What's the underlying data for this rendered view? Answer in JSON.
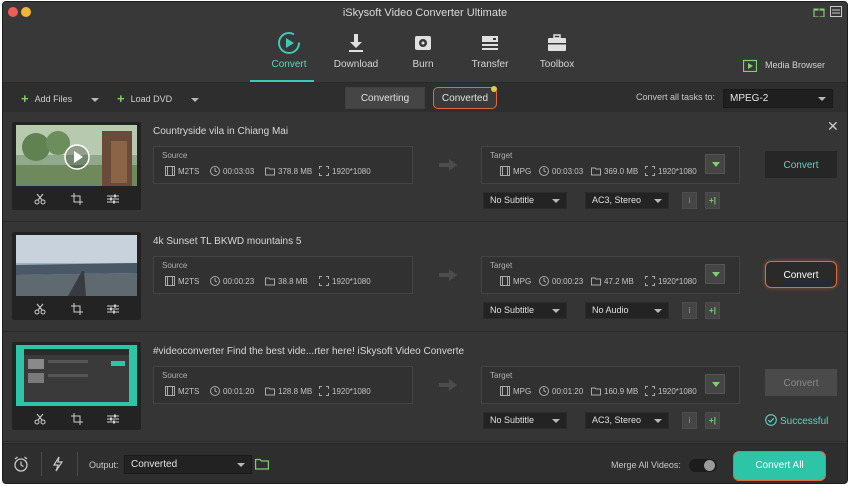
{
  "window": {
    "title": "iSkysoft Video Converter Ultimate"
  },
  "nav": {
    "items": [
      {
        "label": "Convert",
        "icon": "convert-icon",
        "active": true
      },
      {
        "label": "Download",
        "icon": "download-icon"
      },
      {
        "label": "Burn",
        "icon": "burn-icon"
      },
      {
        "label": "Transfer",
        "icon": "transfer-icon"
      },
      {
        "label": "Toolbox",
        "icon": "toolbox-icon"
      }
    ],
    "media_browser": "Media Browser"
  },
  "toolbar": {
    "add_files": "Add Files",
    "load_dvd": "Load DVD",
    "tab_converting": "Converting",
    "tab_converted": "Converted",
    "convert_all_label": "Convert all tasks to:",
    "convert_all_format": "MPEG-2"
  },
  "rows": [
    {
      "title": "Countryside vila in Chiang Mai",
      "source": {
        "label": "Source",
        "format": "M2TS",
        "duration": "00:03:03",
        "size": "378.8 MB",
        "resolution": "1920*1080"
      },
      "target": {
        "label": "Target",
        "format": "MPG",
        "duration": "00:03:03",
        "size": "369.0 MB",
        "resolution": "1920*1080"
      },
      "subtitle": "No Subtitle",
      "audio": "AC3, Stereo",
      "button": "Convert",
      "button_state": "default"
    },
    {
      "title": "4k Sunset TL BKWD mountains 5",
      "source": {
        "label": "Source",
        "format": "M2TS",
        "duration": "00:00:23",
        "size": "38.8 MB",
        "resolution": "1920*1080"
      },
      "target": {
        "label": "Target",
        "format": "MPG",
        "duration": "00:00:23",
        "size": "47.2 MB",
        "resolution": "1920*1080"
      },
      "subtitle": "No Subtitle",
      "audio": "No Audio",
      "button": "Convert",
      "button_state": "highlighted"
    },
    {
      "title": "#videoconverter Find the best vide...rter here!  iSkysoft Video Converte",
      "source": {
        "label": "Source",
        "format": "M2TS",
        "duration": "00:01:20",
        "size": "128.8 MB",
        "resolution": "1920*1080"
      },
      "target": {
        "label": "Target",
        "format": "MPG",
        "duration": "00:01:20",
        "size": "160.9 MB",
        "resolution": "1920*1080"
      },
      "subtitle": "No Subtitle",
      "audio": "AC3, Stereo",
      "button": "Convert",
      "button_state": "disabled",
      "status": "Successful"
    }
  ],
  "bottom": {
    "output_label": "Output:",
    "output_value": "Converted",
    "merge_label": "Merge All Videos:",
    "merge_on": false,
    "convert_all_button": "Convert All"
  },
  "colors": {
    "accent": "#2dc4a8",
    "highlight": "#e06a3e",
    "plus_green": "#7fd16e"
  }
}
